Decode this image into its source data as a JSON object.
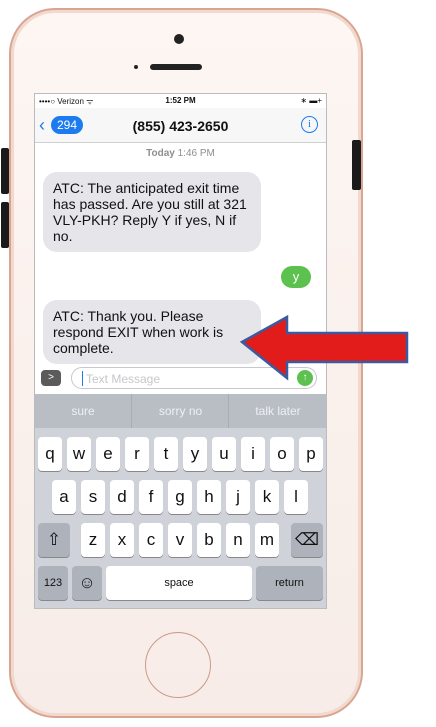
{
  "status_bar": {
    "carrier": "••••○ Verizon ᯤ",
    "time": "1:52 PM",
    "battery": "∗ ▬+"
  },
  "nav": {
    "back_icon": "chevron-left",
    "back_count": "294",
    "title": "(855) 423-2650",
    "info_icon": "i"
  },
  "timestamp": {
    "day": "Today",
    "time": "1:46 PM"
  },
  "messages": [
    {
      "from": "them",
      "text": "ATC: The anticipated exit time has passed.  Are you still at 321  VLY-PKH? Reply Y if yes, N if no."
    },
    {
      "from": "me",
      "text": "y"
    },
    {
      "from": "them",
      "text": "ATC: Thank you. Please respond EXIT when work is complete."
    }
  ],
  "composer": {
    "placeholder": "Text Message",
    "camera_icon": "camera-icon",
    "send_icon": "↑"
  },
  "keyboard": {
    "suggestions": [
      "sure",
      "sorry no",
      "talk later"
    ],
    "row1": [
      "q",
      "w",
      "e",
      "r",
      "t",
      "y",
      "u",
      "i",
      "o",
      "p"
    ],
    "row2": [
      "a",
      "s",
      "d",
      "f",
      "g",
      "h",
      "j",
      "k",
      "l"
    ],
    "row3": [
      "z",
      "x",
      "c",
      "v",
      "b",
      "n",
      "m"
    ],
    "shift": "⇧",
    "delete": "⌫",
    "numbers": "123",
    "emoji": "☺",
    "space": "space",
    "return": "return"
  },
  "annotation": {
    "arrow_color": "#e21b1b",
    "arrow_outline": "#3a5ba0"
  }
}
